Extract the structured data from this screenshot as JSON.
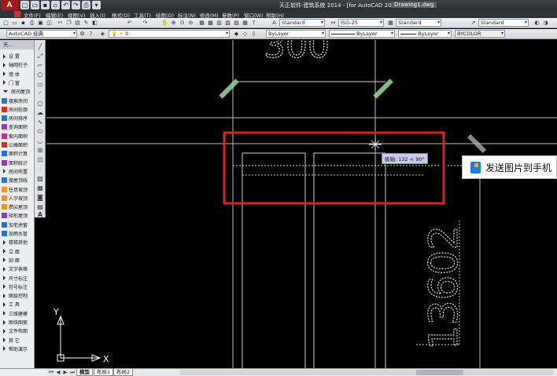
{
  "titlebar": {
    "logo": "A",
    "title": "天正软件-建筑系统 2014 - [for AutoCAD 2010]",
    "document": "Drawing1.dwg"
  },
  "menu": {
    "items": [
      "文件(F)",
      "编辑(E)",
      "视图(V)",
      "插入(I)",
      "格式(O)",
      "工具(T)",
      "绘图(D)",
      "标注(N)",
      "修改(M)",
      "参数(P)",
      "窗口(W)",
      "帮助(H)"
    ]
  },
  "toolbar1": {
    "text_style": "Standard",
    "dim_style": "ISO-25",
    "table_style": "Standard",
    "mleader_style": "Standard"
  },
  "toolbar2": {
    "workspace": "AutoCAD 经典",
    "layer": "0",
    "color": "ByLayer",
    "linetype": "ByLayer",
    "lineweight": "ByLayer",
    "plotstyle": "BYCOLOR"
  },
  "palette": {
    "header": "天...",
    "items": [
      {
        "label": "设    置",
        "icon": "arrow"
      },
      {
        "label": "轴网柱子",
        "icon": "arrow"
      },
      {
        "label": "墙    体",
        "icon": "arrow"
      },
      {
        "label": "门    窗",
        "icon": "arrow"
      },
      {
        "label": "房间屋顶",
        "icon": "arrow-down"
      },
      {
        "label": "搜索房间",
        "icon": "blue"
      },
      {
        "label": "房间轮廓",
        "icon": "red"
      },
      {
        "label": "房间排序",
        "icon": "blue"
      },
      {
        "label": "查询面积",
        "icon": "purple"
      },
      {
        "label": "套内面积",
        "icon": "magenta"
      },
      {
        "label": "公摊面积",
        "icon": "red"
      },
      {
        "label": "面积计算",
        "icon": "blue"
      },
      {
        "label": "面积统计",
        "icon": "purple"
      },
      {
        "label": "房间布置",
        "icon": "arrow"
      },
      {
        "label": "搜屋顶线",
        "icon": "blue"
      },
      {
        "label": "任意坡顶",
        "icon": "orange"
      },
      {
        "label": "人字坡顶",
        "icon": "orange"
      },
      {
        "label": "攒尖屋顶",
        "icon": "orange"
      },
      {
        "label": "矩形屋顶",
        "icon": "purple"
      },
      {
        "label": "加老虎窗",
        "icon": "blue"
      },
      {
        "label": "加雨水管",
        "icon": "blue"
      },
      {
        "label": "楼梯其他",
        "icon": "arrow"
      },
      {
        "label": "立    面",
        "icon": "arrow"
      },
      {
        "label": "剖    面",
        "icon": "arrow"
      },
      {
        "label": "文字表格",
        "icon": "arrow"
      },
      {
        "label": "尺寸标注",
        "icon": "arrow"
      },
      {
        "label": "符号标注",
        "icon": "arrow"
      },
      {
        "label": "图层控制",
        "icon": "arrow"
      },
      {
        "label": "工    具",
        "icon": "arrow"
      },
      {
        "label": "三维建模",
        "icon": "arrow"
      },
      {
        "label": "图块图案",
        "icon": "arrow"
      },
      {
        "label": "文件布图",
        "icon": "arrow"
      },
      {
        "label": "其    它",
        "icon": "arrow"
      },
      {
        "label": "帮助演示",
        "icon": "arrow"
      }
    ]
  },
  "canvas": {
    "top_dimension": "300",
    "vertical_dimension": "13602",
    "ucs_x": "X",
    "ucs_y": "Y",
    "tooltip": "极轴: 132 < 90°"
  },
  "send_to_phone": {
    "label": "发送图片到手机"
  },
  "tabs": {
    "items": [
      "模型",
      "布局1",
      "布局2"
    ],
    "active": 0
  },
  "colors": {
    "highlight_box": "#d8232a",
    "green_tick": "#7dbf7d",
    "gray_tick": "#8a8a8a",
    "line": "#cfcfcf",
    "canvas_bg": "#000000"
  }
}
